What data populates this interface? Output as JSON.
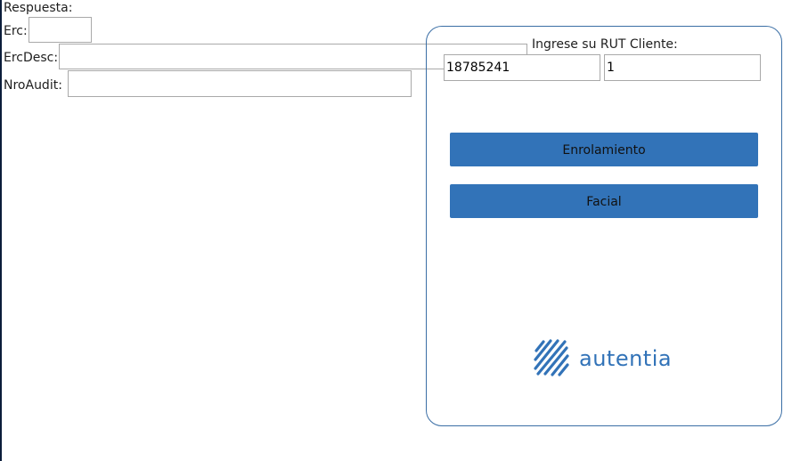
{
  "form": {
    "respuesta_label": "Respuesta:",
    "erc_label": "Erc:",
    "erc_value": "",
    "ercdesc_label": "ErcDesc:",
    "ercdesc_value": "",
    "nroaudit_label": "NroAudit:",
    "nroaudit_value": ""
  },
  "panel": {
    "rut_prompt": "Ingrese su RUT Cliente:",
    "rut_value": "18785241",
    "dv_value": "1",
    "enrolamiento_label": "Enrolamiento",
    "facial_label": "Facial",
    "logo_text": "autentia"
  },
  "colors": {
    "accent": "#3273b8",
    "panel_border": "#3a6ea5"
  }
}
